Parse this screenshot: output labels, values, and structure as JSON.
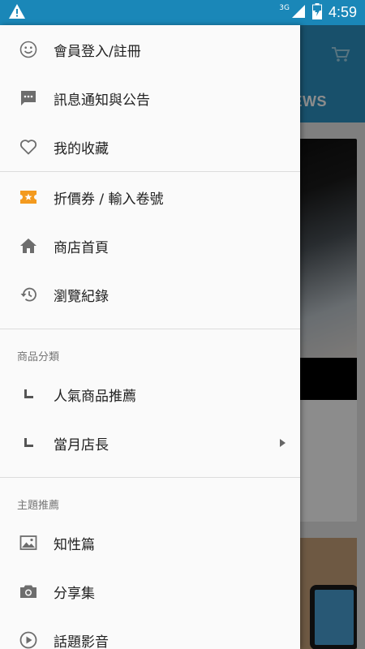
{
  "status_bar": {
    "network": "3G",
    "time": "4:59"
  },
  "background": {
    "tab_label": "EWS"
  },
  "drawer": {
    "account": [
      {
        "label": "會員登入/註冊",
        "icon": "smiley-icon"
      },
      {
        "label": "訊息通知與公告",
        "icon": "message-icon"
      },
      {
        "label": "我的收藏",
        "icon": "heart-icon"
      }
    ],
    "shop": [
      {
        "label": "折價券 / 輸入卷號",
        "icon": "ticket-icon"
      },
      {
        "label": "商店首頁",
        "icon": "home-icon"
      },
      {
        "label": "瀏覽紀錄",
        "icon": "history-icon"
      }
    ],
    "categories": {
      "header": "商品分類",
      "items": [
        {
          "label": "人氣商品推薦"
        },
        {
          "label": "當月店長"
        }
      ]
    },
    "topics": {
      "header": "主題推薦",
      "items": [
        {
          "label": "知性篇",
          "icon": "image-icon"
        },
        {
          "label": "分享集",
          "icon": "camera-icon"
        },
        {
          "label": "話題影音",
          "icon": "play-icon"
        }
      ]
    }
  },
  "colors": {
    "status_bar": "#1a87b8",
    "toolbar": "#2d93c3",
    "ticket_accent": "#f39a1e",
    "icon_gray": "#6d6d6d"
  }
}
